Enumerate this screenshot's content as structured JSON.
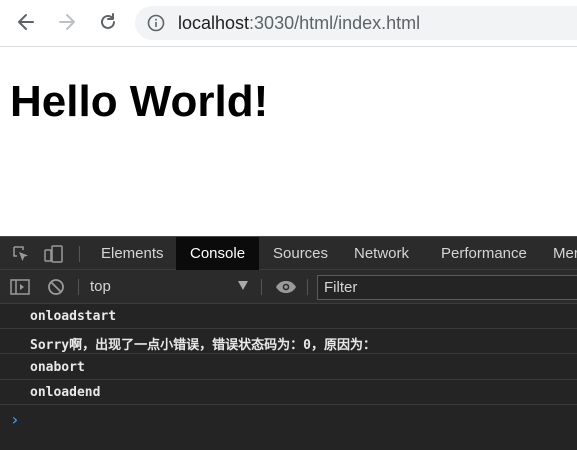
{
  "browser": {
    "url_host": "localhost",
    "url_rest": ":3030/html/index.html",
    "icons": [
      "back-arrow-icon",
      "forward-arrow-icon",
      "reload-icon",
      "info-icon"
    ]
  },
  "page": {
    "heading": "Hello World!"
  },
  "devtools": {
    "tabs": [
      {
        "label": "Elements"
      },
      {
        "label": "Console"
      },
      {
        "label": "Sources"
      },
      {
        "label": "Network"
      },
      {
        "label": "Performance"
      },
      {
        "label": "Mer"
      }
    ],
    "active_tab": "Console",
    "context": "top",
    "filter_placeholder": "Filter",
    "messages": [
      "onloadstart",
      "Sorry啊，出现了一点小错误，错误状态码为：0，原因为：",
      "onabort",
      "onloadend"
    ],
    "prompt_symbol": "›",
    "colors": {
      "background": "#242424",
      "toolbar": "#2b2b2b",
      "active_tab": "#0b0b0b",
      "prompt": "#4aa3ff"
    }
  }
}
